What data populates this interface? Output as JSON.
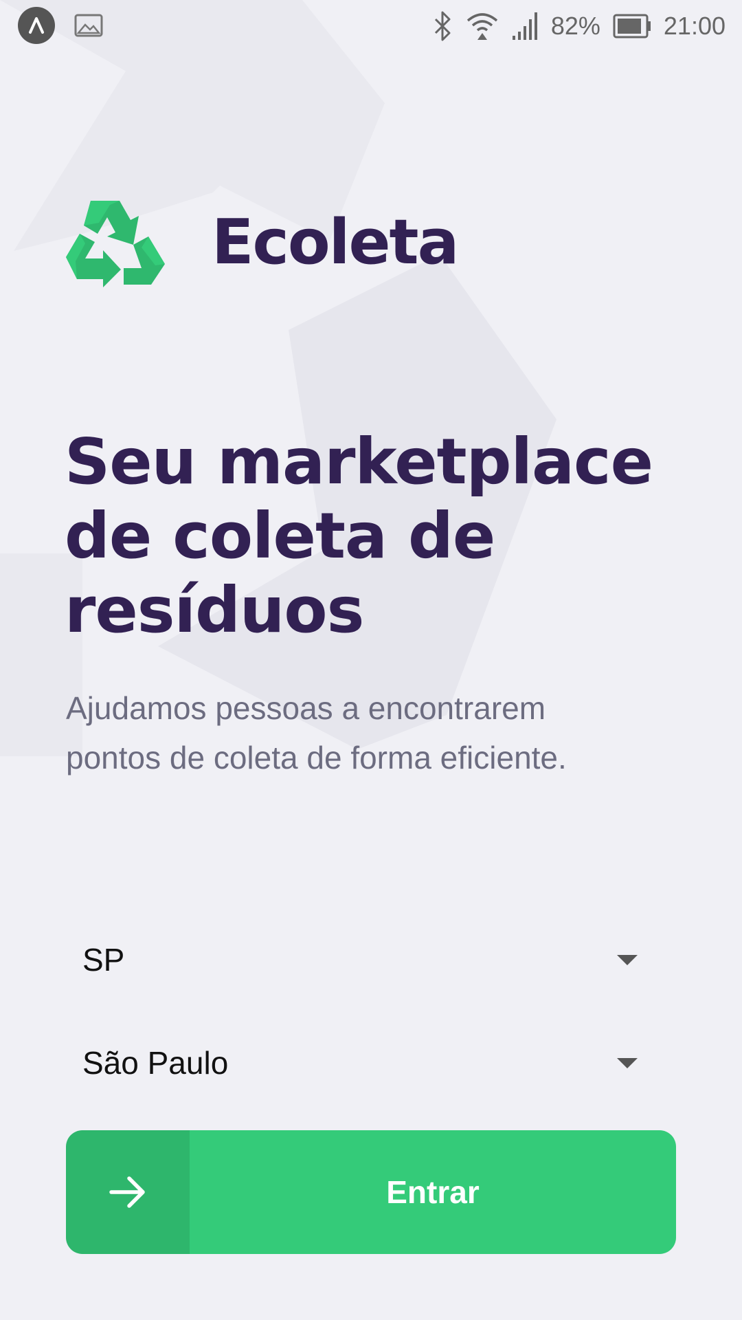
{
  "status_bar": {
    "battery_percent": "82%",
    "time": "21:00",
    "icons": [
      "app-icon",
      "image-icon",
      "bluetooth-icon",
      "wifi-icon",
      "signal-icon",
      "battery-icon"
    ]
  },
  "logo": {
    "name": "Ecoleta",
    "icon": "recycle-icon"
  },
  "headline": {
    "lines": [
      "Seu marketplace",
      "de coleta de",
      "resíduos"
    ]
  },
  "description": {
    "lines": [
      "Ajudamos pessoas a encontrarem",
      "pontos de coleta de forma eficiente."
    ]
  },
  "form": {
    "state_select": {
      "value": "SP"
    },
    "city_select": {
      "value": "São Paulo"
    },
    "enter_button": {
      "label": "Entrar",
      "icon": "arrow-right-icon"
    }
  },
  "colors": {
    "primary": "#34cb79",
    "title": "#322153",
    "text": "#6c6c80",
    "background": "#f0f0f5"
  }
}
